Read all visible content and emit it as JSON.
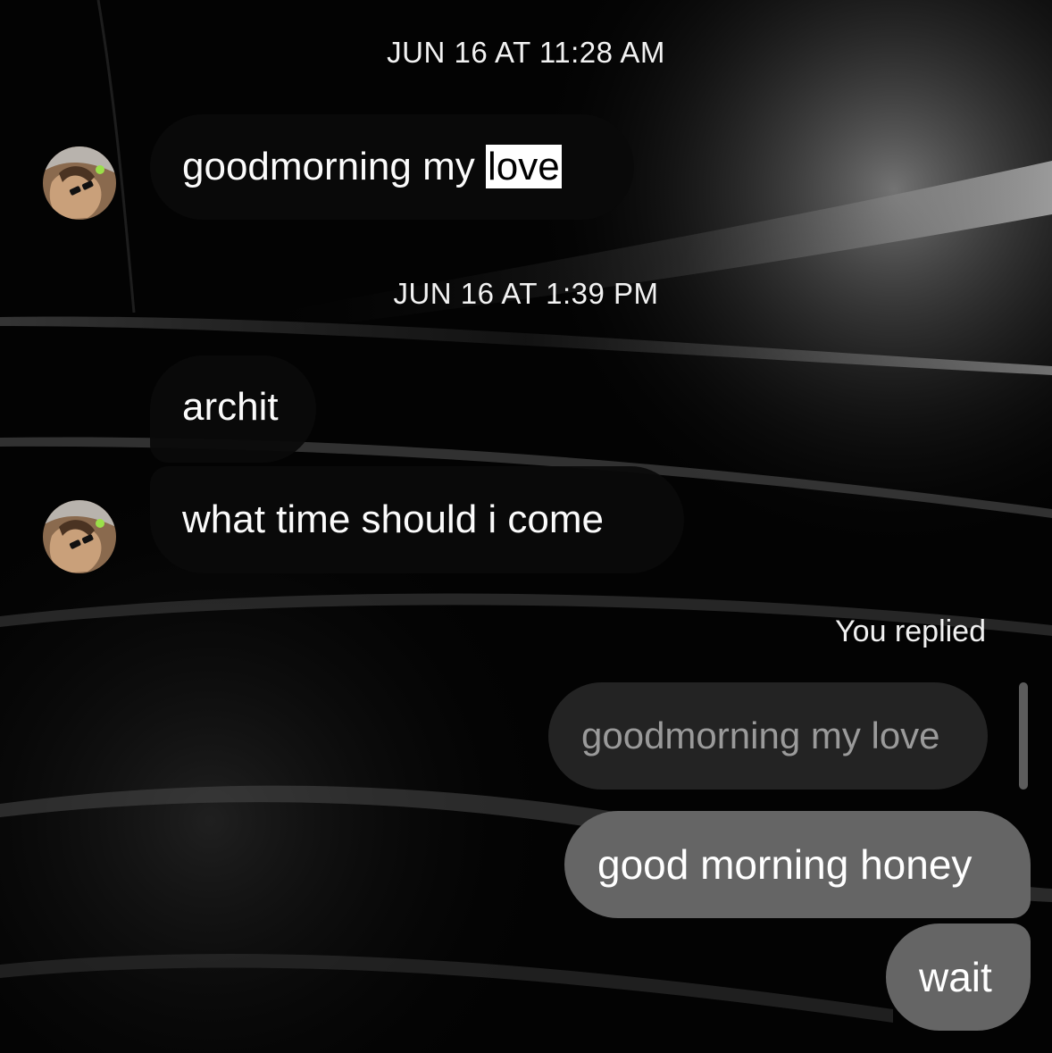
{
  "thread": {
    "timestamp_1": "JUN 16 AT 11:28 AM",
    "timestamp_2": "JUN 16 AT 1:39 PM",
    "messages_incoming": [
      {
        "text_before": "goodmorning my ",
        "text_highlighted": "love"
      },
      {
        "text": "archit"
      },
      {
        "text": "what time should i come"
      }
    ],
    "reply": {
      "label": "You replied",
      "quoted_text": "goodmorning my love"
    },
    "messages_outgoing": [
      {
        "text": "good morning honey"
      },
      {
        "text": "wait"
      }
    ]
  },
  "colors": {
    "incoming_bubble": "#0a0a0a",
    "outgoing_bubble": "#656565",
    "quoted_bubble": "#262626",
    "highlight": "#ffffff"
  }
}
